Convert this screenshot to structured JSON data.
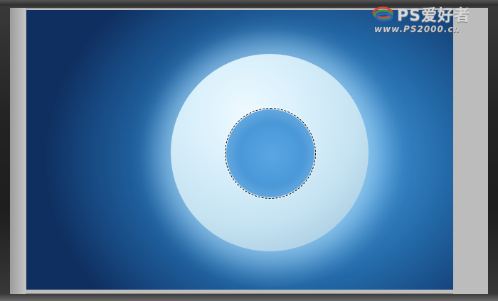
{
  "watermark": {
    "title": "PS爱好者",
    "url": "www.PS2000.cn",
    "logo_icon": "ps-swirl-logo-icon"
  },
  "canvas": {
    "background_color_center": "#6fb3e6",
    "background_color_edge": "#0f2f60",
    "ring_color": "#d9f0fb",
    "inner_color": "#4a98d8"
  },
  "selection": {
    "shape": "circle-marquee"
  }
}
